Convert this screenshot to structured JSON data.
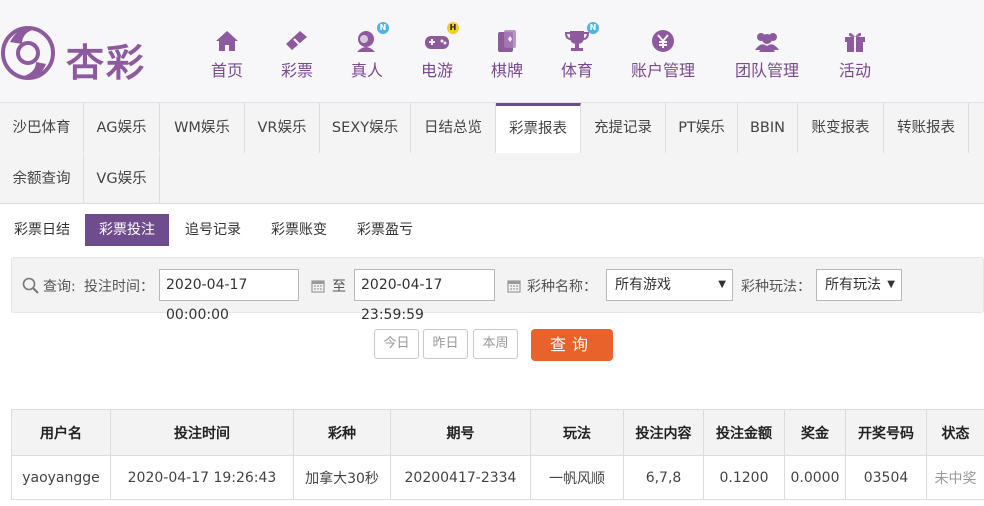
{
  "brand": {
    "name": "杏彩"
  },
  "nav": [
    {
      "label": "首页",
      "icon": "home-icon",
      "badge": ""
    },
    {
      "label": "彩票",
      "icon": "lottery-ticket-icon",
      "badge": ""
    },
    {
      "label": "真人",
      "icon": "live-dealer-icon",
      "badge": "N"
    },
    {
      "label": "电游",
      "icon": "gamepad-icon",
      "badge": "H"
    },
    {
      "label": "棋牌",
      "icon": "cards-icon",
      "badge": ""
    },
    {
      "label": "体育",
      "icon": "trophy-icon",
      "badge": "N"
    },
    {
      "label": "账户管理",
      "icon": "yen-icon",
      "badge": ""
    },
    {
      "label": "团队管理",
      "icon": "team-icon",
      "badge": ""
    },
    {
      "label": "活动",
      "icon": "gift-icon",
      "badge": ""
    }
  ],
  "categories": [
    "沙巴体育",
    "AG娱乐",
    "WM娱乐",
    "VR娱乐",
    "SEXY娱乐",
    "日结总览",
    "彩票报表",
    "充提记录",
    "PT娱乐",
    "BBIN",
    "账变报表",
    "转账报表",
    "余额查询",
    "VG娱乐"
  ],
  "active_category": "彩票报表",
  "subtabs": [
    "彩票日结",
    "彩票投注",
    "追号记录",
    "彩票账变",
    "彩票盈亏"
  ],
  "active_subtab": "彩票投注",
  "query": {
    "label": "查询:",
    "time_label": "投注时间：",
    "start": "2020-04-17 00:00:00",
    "to": "至",
    "end": "2020-04-17 23:59:59",
    "lottery_label": "彩种名称：",
    "lottery_value": "所有游戏",
    "play_label": "彩种玩法：",
    "play_value": "所有玩法"
  },
  "quick_buttons": [
    "今日",
    "昨日",
    "本周"
  ],
  "search_button": "查询",
  "table": {
    "headers": [
      "用户名",
      "投注时间",
      "彩种",
      "期号",
      "玩法",
      "投注内容",
      "投注金额",
      "奖金",
      "开奖号码",
      "状态"
    ],
    "rows": [
      [
        "yaoyangge",
        "2020-04-17 19:26:43",
        "加拿大30秒",
        "20200417-2334",
        "一帆风顺",
        "6,7,8",
        "0.1200",
        "0.0000",
        "03504",
        "未中奖"
      ]
    ]
  },
  "colors": {
    "brand": "#6f4c8e",
    "nav_text": "#7a4a8f",
    "search_button": "#e9622b"
  }
}
